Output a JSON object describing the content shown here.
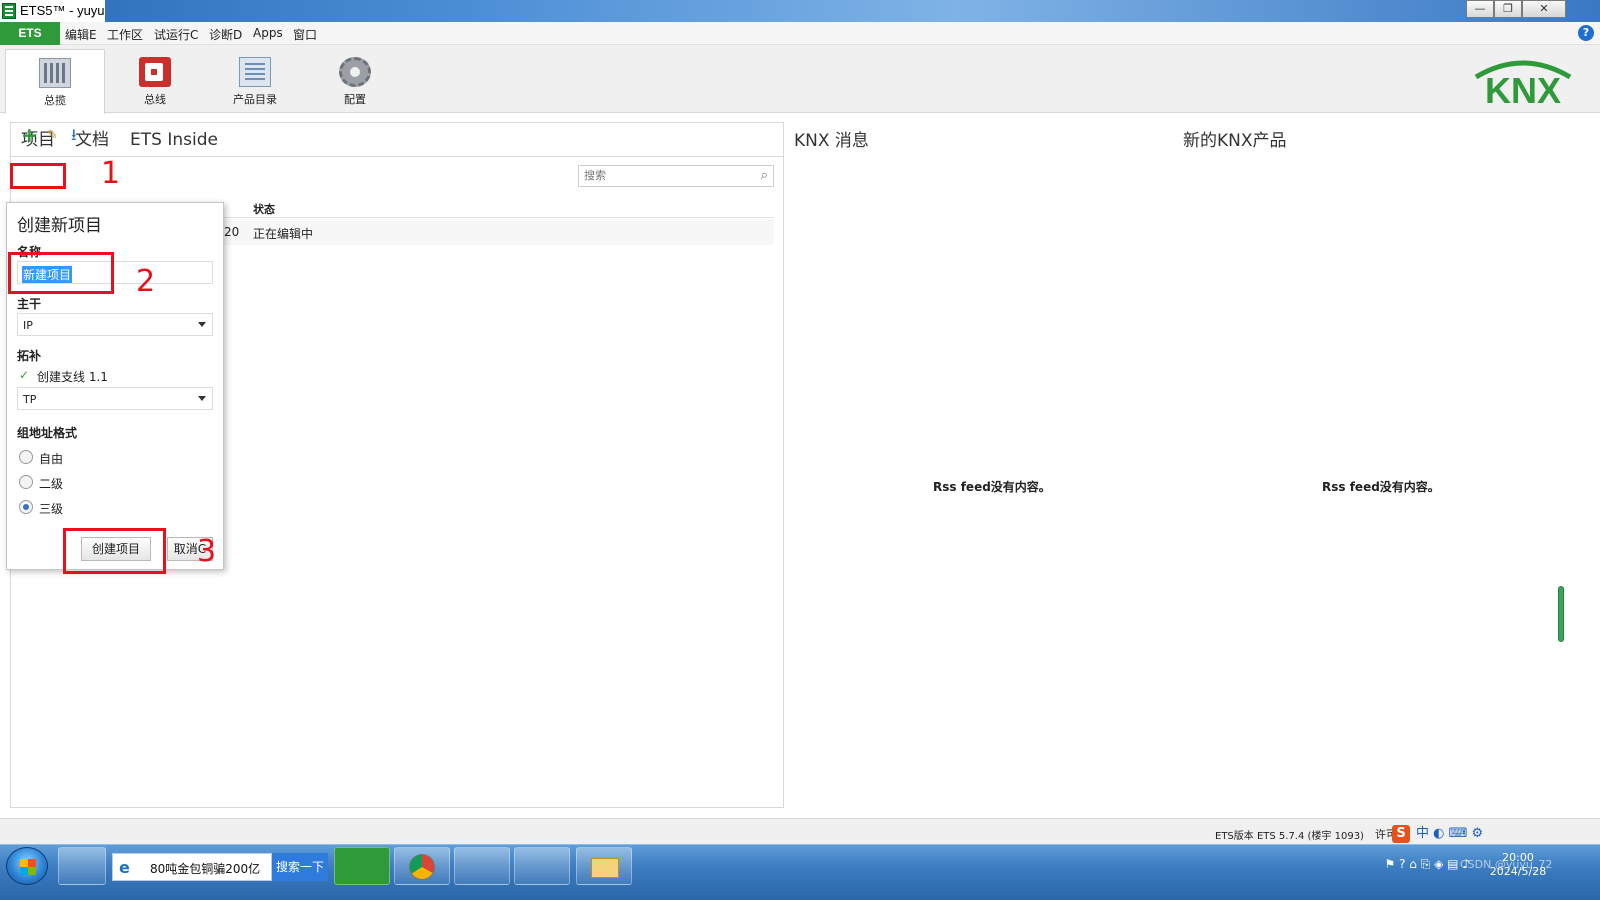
{
  "window": {
    "title": "ETS5™ - yuyu",
    "min_label": "—",
    "restore_label": "❐",
    "close_label": "✕"
  },
  "menu": {
    "app_tab": "ETS",
    "items": [
      "编辑E",
      "工作区",
      "试运行C",
      "诊断D",
      "Apps",
      "窗口"
    ],
    "help_label": "?"
  },
  "ribbon": {
    "buttons": [
      {
        "label": "总揽",
        "icon": "overview-icon"
      },
      {
        "label": "总线",
        "icon": "bus-icon"
      },
      {
        "label": "产品目录",
        "icon": "catalog-icon"
      },
      {
        "label": "配置",
        "icon": "settings-gear-icon"
      }
    ],
    "logo_text": "KNX"
  },
  "left_panel": {
    "tabs": [
      "项目",
      "文档",
      "ETS Inside"
    ],
    "search_placeholder": "搜索",
    "columns": {
      "status": "状态"
    },
    "row": {
      "time_fragment": ":20",
      "status": "正在编辑中"
    }
  },
  "create_dialog": {
    "title": "创建新项目",
    "name_label": "名称",
    "name_value": "新建项目",
    "backbone_label": "主干",
    "backbone_value": "IP",
    "topology_label": "拓补",
    "create_line_label": "创建支线 1.1",
    "create_line_checked": true,
    "medium_value": "TP",
    "ga_format_label": "组地址格式",
    "ga_options": [
      "自由",
      "二级",
      "三级"
    ],
    "ga_selected": "三级",
    "create_button": "创建项目",
    "cancel_button": "取消C"
  },
  "annotations": [
    "1",
    "2",
    "3"
  ],
  "news": {
    "knx_news_title": "KNX 消息",
    "new_products_title": "新的KNX产品",
    "empty_text_left": "Rss feed没有内容。",
    "empty_text_right": "Rss feed没有内容。"
  },
  "statusbar": {
    "version": "ETS版本 ETS 5.7.4 (楼宇 1093)",
    "license": "许可",
    "ime": "中"
  },
  "taskbar": {
    "ie_item": "80吨金包铜骗200亿",
    "search_button": "搜索一下",
    "clock_time": "20:00",
    "clock_date": "2024/5/28",
    "watermark": "CSDN @yuyu_72"
  },
  "colors": {
    "ets_green": "#2e9a3a",
    "annotation_red": "#e8101a",
    "selection_blue": "#3399ff"
  }
}
